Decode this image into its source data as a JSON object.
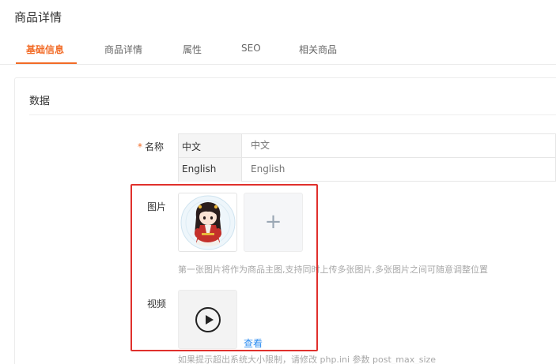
{
  "page": {
    "title": "商品详情"
  },
  "tabs": [
    {
      "label": "基础信息",
      "active": true
    },
    {
      "label": "商品详情",
      "active": false
    },
    {
      "label": "属性",
      "active": false
    },
    {
      "label": "SEO",
      "active": false
    },
    {
      "label": "相关商品",
      "active": false
    }
  ],
  "section": {
    "title": "数据"
  },
  "form": {
    "name": {
      "required_mark": "*",
      "label": "名称",
      "rows": [
        {
          "lang": "中文",
          "value": "中文"
        },
        {
          "lang": "English",
          "value": "English"
        }
      ]
    },
    "images": {
      "label": "图片",
      "upload_symbol": "+",
      "hint": "第一张图片将作为商品主图,支持同时上传多张图片,多张图片之间可随意调整位置"
    },
    "video": {
      "label": "视频",
      "view_link": "查看",
      "hint": "如果提示超出系统大小限制，请修改 php.ini 参数 post_max_size"
    }
  },
  "colors": {
    "accent": "#f26b26",
    "link": "#2d8cf0",
    "highlight": "#e0302c"
  }
}
